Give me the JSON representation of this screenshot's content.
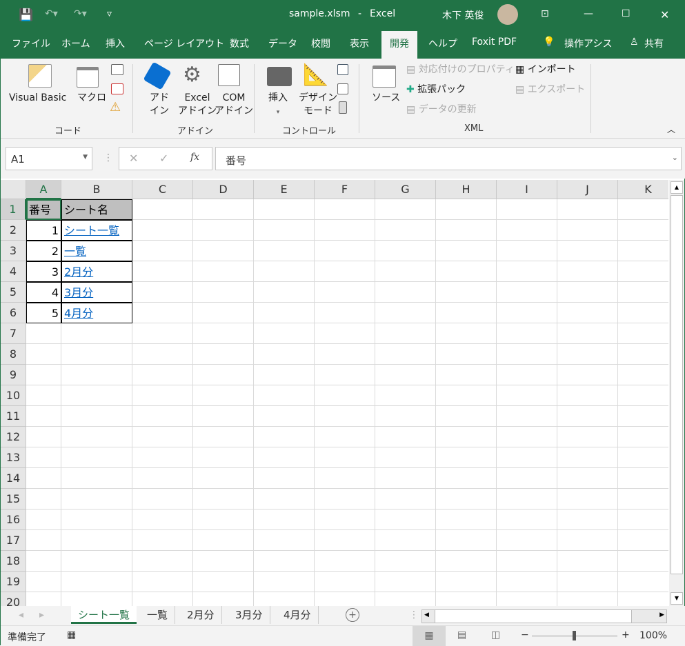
{
  "title": {
    "file": "sample.xlsm",
    "sep": "-",
    "app": "Excel",
    "user": "木下 英俊"
  },
  "tabs": [
    "ファイル",
    "ホーム",
    "挿入",
    "ページ レイアウト",
    "数式",
    "データ",
    "校閲",
    "表示",
    "開発",
    "ヘルプ",
    "Foxit PDF",
    "操作アシス",
    "共有"
  ],
  "active_tab": "開発",
  "ribbon": {
    "code": {
      "label": "コード",
      "visual_basic": "Visual Basic",
      "macro": "マクロ"
    },
    "addin": {
      "label": "アドイン",
      "addin1": "アド",
      "addin2": "イン",
      "excel1": "Excel",
      "excel2": "アドイン",
      "com1": "COM",
      "com2": "アドイン"
    },
    "control": {
      "label": "コントロール",
      "insert": "挿入",
      "design1": "デザイン",
      "design2": "モード"
    },
    "xml": {
      "label": "XML",
      "source": "ソース",
      "map_props": "対応付けのプロパティ",
      "expansion": "拡張パック",
      "refresh": "データの更新",
      "import": "インポート",
      "export": "エクスポート"
    }
  },
  "formula": {
    "name_box": "A1",
    "fx": "fx",
    "value": "番号"
  },
  "columns": [
    "A",
    "B",
    "C",
    "D",
    "E",
    "F",
    "G",
    "H",
    "I",
    "J",
    "K"
  ],
  "rows": [
    "1",
    "2",
    "3",
    "4",
    "5",
    "6",
    "7",
    "8",
    "9",
    "10",
    "11",
    "12",
    "13",
    "14",
    "15",
    "16",
    "17",
    "18",
    "19",
    "20"
  ],
  "table": {
    "headers": [
      "番号",
      "シート名"
    ],
    "rows": [
      [
        "1",
        "シート一覧"
      ],
      [
        "2",
        "一覧"
      ],
      [
        "3",
        "2月分"
      ],
      [
        "4",
        "3月分"
      ],
      [
        "5",
        "4月分"
      ]
    ]
  },
  "sheets": [
    "シート一覧",
    "一覧",
    "2月分",
    "3月分",
    "4月分"
  ],
  "active_sheet": "シート一覧",
  "status": {
    "ready": "準備完了",
    "zoom": "100%",
    "zoom_minus": "−",
    "zoom_plus": "+"
  },
  "colors": {
    "brand": "#217346",
    "link": "#0563c1"
  }
}
